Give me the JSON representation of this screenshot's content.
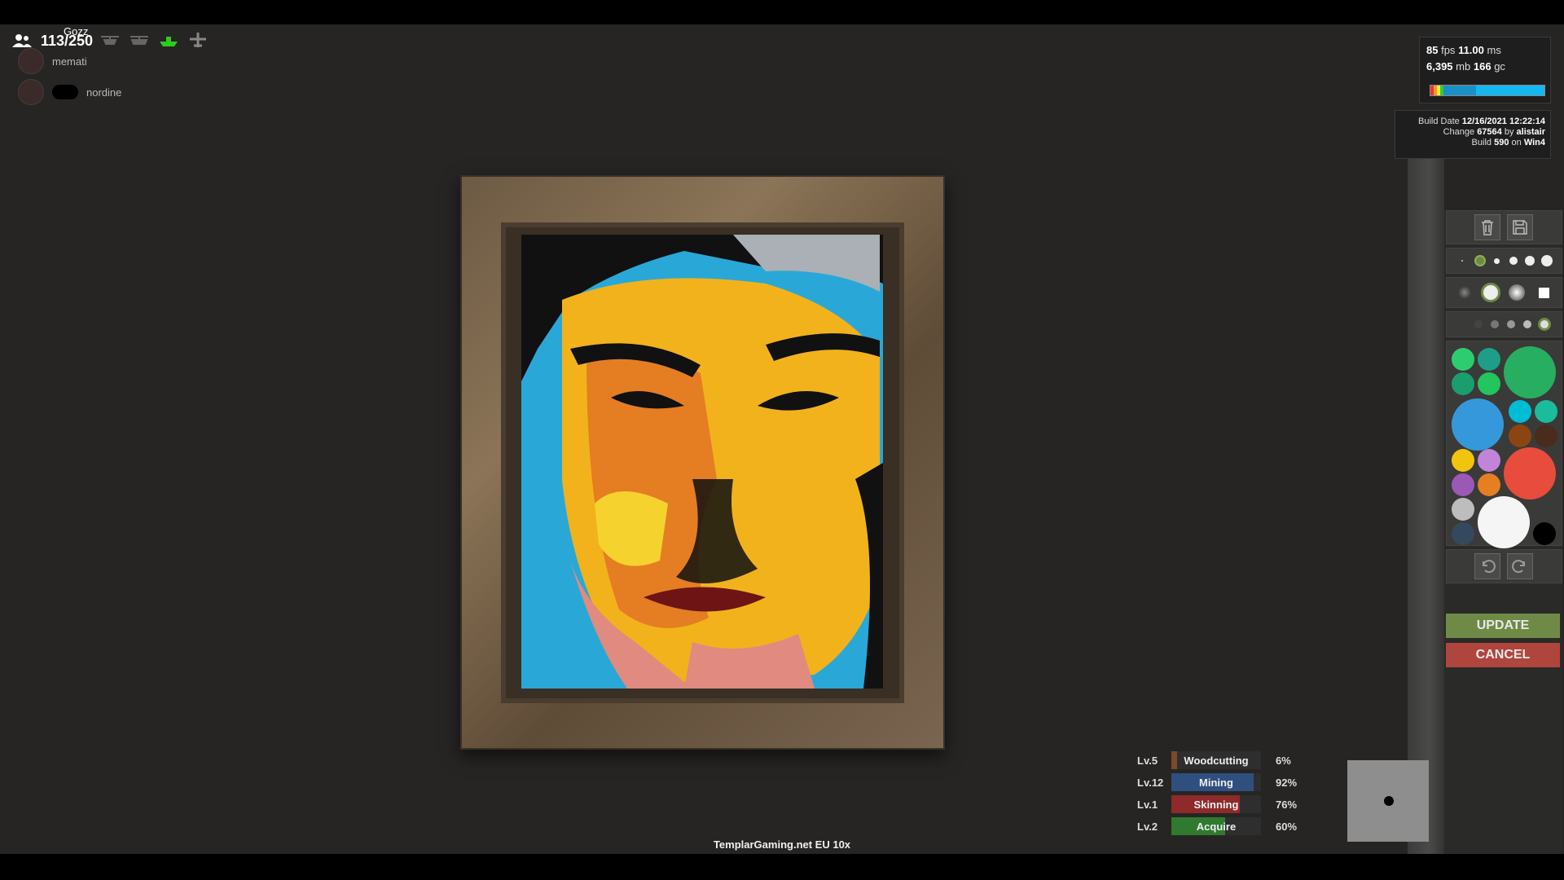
{
  "hud": {
    "player_count": "113/250",
    "player_name": "Gozz",
    "team": [
      {
        "name": "memati"
      },
      {
        "name": "nordine"
      }
    ],
    "vehicle_icons": [
      "minicopter-icon",
      "scrap-helicopter-icon",
      "boat-icon",
      "plane-icon"
    ]
  },
  "perf": {
    "fps": "85",
    "fps_label": "fps",
    "ms": "11.00",
    "ms_label": "ms",
    "mb": "6,395",
    "mb_label": "mb",
    "gc": "166",
    "gc_label": "gc"
  },
  "build": {
    "date_label": "Build Date",
    "date": "12/16/2021 12:22:14",
    "change_label": "Change",
    "change": "67564",
    "by_label": "by",
    "author": "alistair",
    "build_label": "Build",
    "build": "590",
    "on_label": "on",
    "platform": "Win4"
  },
  "tools": {
    "delete_icon": "trash-icon",
    "save_icon": "save-icon",
    "undo_icon": "undo-icon",
    "redo_icon": "redo-icon",
    "update_label": "UPDATE",
    "cancel_label": "CANCEL"
  },
  "palette": {
    "colors": [
      "#2ecc71",
      "#1e9e88",
      "#1a9e6e",
      "#22c55e",
      "#27ae60",
      "#3498db",
      "#00bcd4",
      "#1abc9c",
      "#8b4513",
      "#4a2c1e",
      "#f1c40f",
      "#c084d8",
      "#e74c3c",
      "#9b59b6",
      "#e67e22",
      "#bdbdbd",
      "#f5f5f5",
      "#34495e",
      "#000000"
    ]
  },
  "skills": [
    {
      "level": "Lv.5",
      "name": "Woodcutting",
      "percent": "6%",
      "fill": 0.06,
      "color": "#7a4a2a"
    },
    {
      "level": "Lv.12",
      "name": "Mining",
      "percent": "92%",
      "fill": 0.92,
      "color": "#2f4f7f"
    },
    {
      "level": "Lv.1",
      "name": "Skinning",
      "percent": "76%",
      "fill": 0.76,
      "color": "#8e2a2a"
    },
    {
      "level": "Lv.2",
      "name": "Acquire",
      "percent": "60%",
      "fill": 0.6,
      "color": "#2f7a2f"
    }
  ],
  "server_name": "TemplarGaming.net EU 10x"
}
